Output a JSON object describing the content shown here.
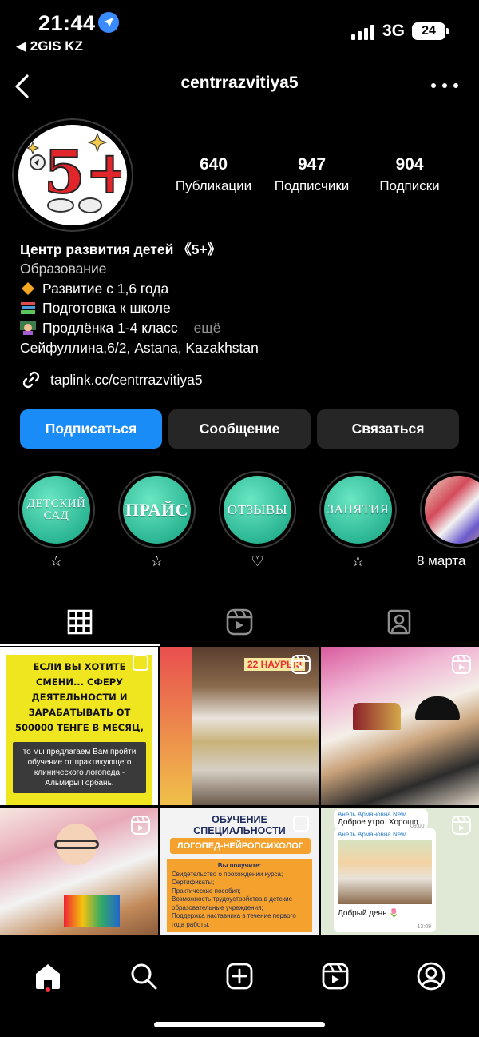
{
  "status_bar": {
    "time": "21:44",
    "back_app": "◀ 2GIS KZ",
    "network": "3G",
    "battery": "24"
  },
  "header": {
    "username": "centrrazvitiya5"
  },
  "profile": {
    "avatar_logo_text": "5+",
    "stats": [
      {
        "number": "640",
        "label": "Публикации"
      },
      {
        "number": "947",
        "label": "Подписчики"
      },
      {
        "number": "904",
        "label": "Подписки"
      }
    ],
    "bio": {
      "name": "Центр развития детей 《5+》",
      "category": "Образование",
      "lines": [
        {
          "icon": "orange-diamond-icon",
          "text": "Развитие с 1,6 года"
        },
        {
          "icon": "books-icon",
          "text": "Подготовка к школе"
        },
        {
          "icon": "teacher-icon",
          "text": "Продлёнка 1-4 класс"
        }
      ],
      "more": "ещё",
      "address": "Сейфуллина,6/2, Astana, Kazakhstan",
      "link": "taplink.cc/centrrazvitiya5"
    },
    "buttons": {
      "follow": "Подписаться",
      "message": "Сообщение",
      "contact": "Связаться"
    }
  },
  "highlights": [
    {
      "title": "ДЕТСКИЙ САД",
      "icon": "star-icon",
      "glyph": "☆"
    },
    {
      "title": "ПРАЙС",
      "icon": "star-icon",
      "glyph": "☆"
    },
    {
      "title": "ОТЗЫВЫ",
      "icon": "heart-icon",
      "glyph": "♡"
    },
    {
      "title": "ЗАНЯТИЯ",
      "icon": "star-icon",
      "glyph": "☆"
    },
    {
      "title": "8 марта",
      "icon": "photo-cover",
      "glyph": ""
    }
  ],
  "tabs": [
    "grid-icon",
    "reels-icon",
    "tagged-icon"
  ],
  "posts": [
    {
      "kind": "text-card",
      "headline": "ЕСЛИ ВЫ ХОТИТЕ СМЕНИ... СФЕРУ ДЕЯТЕЛЬНОСТИ И ЗАРАБАТЫВАТЬ ОТ 500000 ТЕНГЕ В МЕСЯЦ,",
      "body": "то мы предлагаем Вам пройти обучение от практикующего клинического логопеда - Альмиры Горбань.",
      "overlay": "multi-icon"
    },
    {
      "kind": "photo",
      "caption": "22 НАУРЫЗ",
      "overlay": "reel-icon"
    },
    {
      "kind": "photo",
      "caption": "",
      "overlay": "reel-icon"
    },
    {
      "kind": "photo",
      "caption": "",
      "overlay": "reel-icon"
    },
    {
      "kind": "text-card",
      "headline": "ОБУЧЕНИЕ СПЕЦИАЛЬНОСТИ",
      "subtitle": "ЛОГОПЕД-НЕЙРОПСИХОЛОГ",
      "intro": "Вы получите:",
      "items": [
        "Свидетельство о прохождении курса;",
        "Сертификаты;",
        "Практические пособия;",
        "Возможность трудоустройства в детские образовательные учреждения;",
        "Поддержка наставника в течение первого года работы."
      ],
      "overlay": "multi-icon"
    },
    {
      "kind": "chat-screenshot",
      "sender1": "Анель Армановна New",
      "msg1": "Доброе утро. Хорошо",
      "time1": "09:00",
      "sender2": "Анель Армановна New",
      "msg2": "Добрый день 🌷",
      "time2": "13:09",
      "overlay": "reel-icon"
    }
  ],
  "bottom_nav": [
    "home-icon",
    "search-icon",
    "create-icon",
    "reels-icon",
    "profile-icon"
  ]
}
